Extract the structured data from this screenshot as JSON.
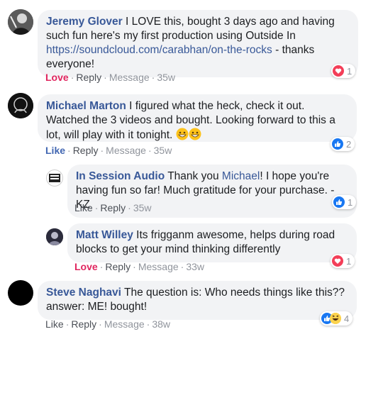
{
  "comments": [
    {
      "author": "Jeremy Glover",
      "text": "I LOVE this, bought 3 days ago and having such fun here's my first production using Outside In",
      "link": "https://soundcloud.com/carabhan/on-the-rocks",
      "text_after": "- thanks everyone!",
      "action": "Love",
      "reply": "Reply",
      "message": "Message",
      "time": "35w",
      "reaction_icon": "love-icon",
      "reaction_count": "1"
    },
    {
      "author": "Michael Marton",
      "text": "I figured what the heck, check it out. Watched the 3 videos and bought. Looking forward to this a lot, will play with it tonight.",
      "emoji": "grinning-face-emoji",
      "action": "Like",
      "reply": "Reply",
      "message": "Message",
      "time": "35w",
      "reaction_icon": "like-icon",
      "reaction_count": "2"
    },
    {
      "author": "In Session Audio",
      "text_before": "Thank you",
      "mention": "Michael",
      "text_after": "! I hope you're having fun so far! Much gratitude for your purchase. - KZ",
      "action": "Like",
      "reply": "Reply",
      "time": "35w",
      "reaction_icon": "like-icon",
      "reaction_count": "1"
    },
    {
      "author": "Matt Willey",
      "text": "Its frigganm awesome, helps during road blocks to get your mind thinking differently",
      "action": "Love",
      "reply": "Reply",
      "message": "Message",
      "time": "33w",
      "reaction_icon": "love-icon",
      "reaction_count": "1"
    },
    {
      "author": "Steve Naghavi",
      "text": "The question is: Who needs things like this?? answer: ME! bought!",
      "action": "Like",
      "reply": "Reply",
      "message": "Message",
      "time": "38w",
      "reaction_icons": [
        "like-icon",
        "haha-icon"
      ],
      "reaction_count": "4"
    }
  ],
  "separator": "·",
  "colors": {
    "name_blue": "#385898",
    "like_blue": "#4267b2",
    "love_red": "#e0245e",
    "bubble_bg": "#f2f3f5",
    "meta_gray": "#90949c"
  }
}
